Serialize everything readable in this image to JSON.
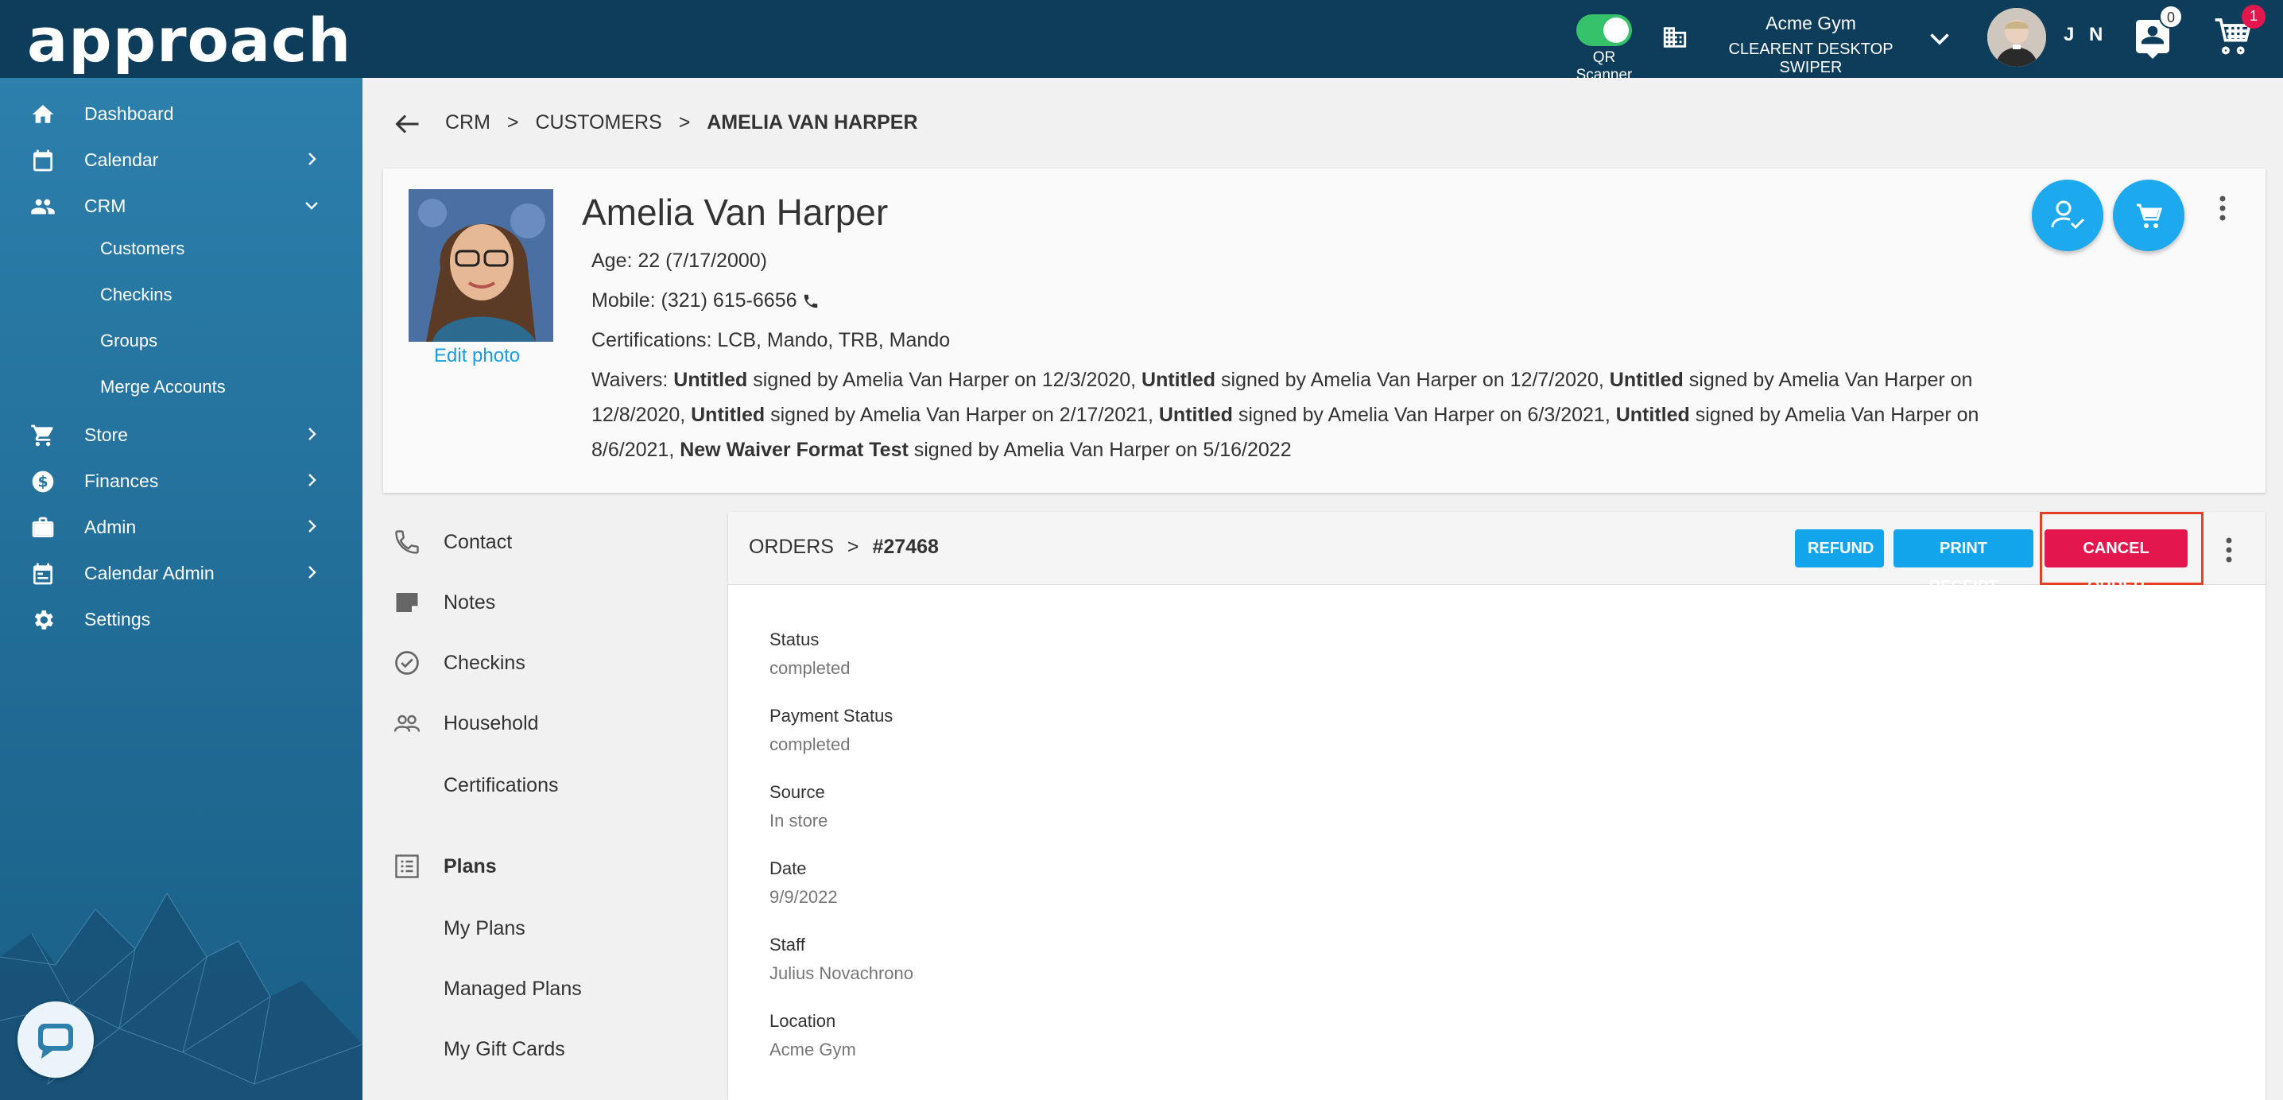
{
  "app": {
    "logo_text": "approach"
  },
  "topbar": {
    "qr_label": "QR Scanner",
    "gym_name": "Acme Gym",
    "gym_device": "CLEARENT DESKTOP SWIPER",
    "user_initials": "J N",
    "notif_count": "0",
    "cart_count": "1"
  },
  "sidebar": {
    "items": [
      {
        "label": "Dashboard",
        "icon": "home-icon"
      },
      {
        "label": "Calendar",
        "icon": "calendar-icon"
      },
      {
        "label": "CRM",
        "icon": "people-icon"
      },
      {
        "label": "Store",
        "icon": "cart-icon"
      },
      {
        "label": "Finances",
        "icon": "dollar-icon"
      },
      {
        "label": "Admin",
        "icon": "briefcase-icon"
      },
      {
        "label": "Calendar Admin",
        "icon": "calendar-admin-icon"
      },
      {
        "label": "Settings",
        "icon": "gear-icon"
      }
    ],
    "crm_sub": [
      "Customers",
      "Checkins",
      "Groups",
      "Merge Accounts"
    ]
  },
  "breadcrumb": {
    "crm": "CRM",
    "sep": ">",
    "customers": "CUSTOMERS",
    "current": "AMELIA VAN HARPER"
  },
  "profile": {
    "name": "Amelia Van Harper",
    "edit_photo": "Edit photo",
    "age": "Age: 22 (7/17/2000)",
    "mobile": "Mobile: (321) 615-6656",
    "certifications": "Certifications: LCB, Mando, TRB, Mando",
    "waivers_label": "Waivers:",
    "waivers": [
      {
        "title": "Untitled",
        "text": " signed by Amelia Van Harper on 12/3/2020, "
      },
      {
        "title": "Untitled",
        "text": " signed by Amelia Van Harper on 12/7/2020, "
      },
      {
        "title": "Untitled",
        "text": " signed by Amelia Van Harper on 12/8/2020, "
      },
      {
        "title": "Untitled",
        "text": " signed by Amelia Van Harper on 2/17/2021, "
      },
      {
        "title": "Untitled",
        "text": " signed by Amelia Van Harper on 6/3/2021, "
      },
      {
        "title": "Untitled",
        "text": " signed by Amelia Van Harper on 8/6/2021, "
      },
      {
        "title": "New Waiver Format Test",
        "text": " signed by Amelia Van Harper on 5/16/2022"
      }
    ]
  },
  "left_menu": {
    "items": [
      "Contact",
      "Notes",
      "Checkins",
      "Household",
      "Certifications"
    ],
    "plans_heading": "Plans",
    "plans": [
      "My Plans",
      "Managed Plans",
      "My Gift Cards"
    ]
  },
  "orders": {
    "label": "ORDERS",
    "sep": ">",
    "number": "#27468",
    "refund": "REFUND",
    "print_receipt": "PRINT RECEIPT",
    "cancel_order": "CANCEL ORDER",
    "fields": [
      {
        "label": "Status",
        "value": "completed"
      },
      {
        "label": "Payment Status",
        "value": "completed"
      },
      {
        "label": "Source",
        "value": "In store"
      },
      {
        "label": "Date",
        "value": "9/9/2022"
      },
      {
        "label": "Staff",
        "value": "Julius Novachrono"
      },
      {
        "label": "Location",
        "value": "Acme Gym"
      }
    ]
  },
  "colors": {
    "topbar": "#0e3d5c",
    "sidebar": "#2575a3",
    "accent": "#13a5ec",
    "danger": "#e3174d",
    "highlight": "#e53f24"
  }
}
